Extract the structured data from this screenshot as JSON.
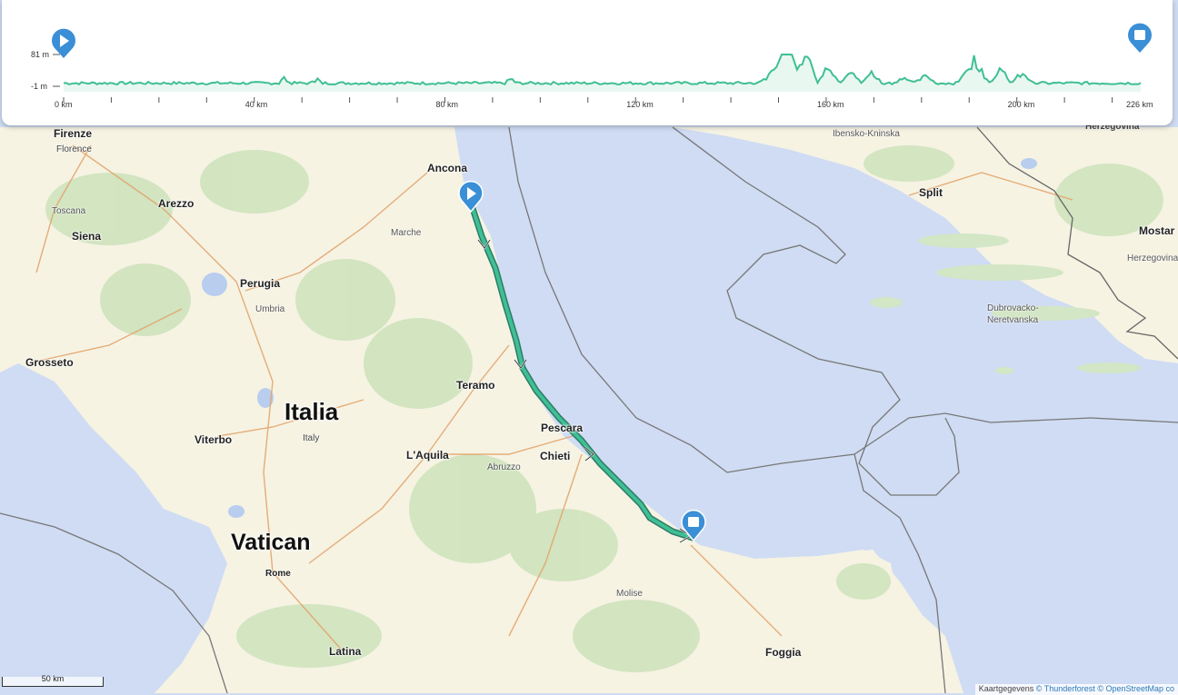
{
  "elevation_profile": {
    "y_axis": {
      "max_label": "81 m",
      "min_label": "-1 m"
    },
    "x_axis": {
      "labels": [
        "0 km",
        "40 km",
        "80 km",
        "120 km",
        "160 km",
        "200 km",
        "226 km"
      ]
    },
    "total_distance_km": 226,
    "line_color": "#3fbf94",
    "start_icon": "play-marker-icon",
    "end_icon": "finish-square-marker-icon"
  },
  "route": {
    "color": "#3c9a84",
    "start_icon": "play-marker-icon",
    "end_icon": "finish-square-marker-icon",
    "direction_icon": "route-direction-arrow-icon"
  },
  "map_labels": {
    "firenze": "Firenze",
    "florence": "Florence",
    "ancona": "Ancona",
    "arezzo": "Arezzo",
    "toscana": "Toscana",
    "siena": "Siena",
    "marche": "Marche",
    "perugia": "Perugia",
    "umbria": "Umbria",
    "grosseto": "Grosseto",
    "teramo": "Teramo",
    "italia": "Italia",
    "italy": "Italy",
    "pescara": "Pescara",
    "viterbo": "Viterbo",
    "laquila": "L'Aquila",
    "chieti": "Chieti",
    "abruzzo": "Abruzzo",
    "vatican": "Vatican",
    "rome": "Rome",
    "molise": "Molise",
    "latina": "Latina",
    "foggia": "Foggia",
    "split": "Split",
    "sibensko": "Ibensko-Kninska",
    "mostar": "Mostar",
    "herzegovina_top": "Herzegovina",
    "herzegovina_right": "Herzegovina-I",
    "dubrovacko1": "Dubrovacko-",
    "dubrovacko2": "Neretvanska"
  },
  "scale": {
    "label": "50 km"
  },
  "attribution": {
    "prefix": "Kaartgegevens",
    "tf": "© Thunderforest",
    "osm": "© OpenStreetMap co"
  },
  "colors": {
    "sea": "#cfdcf3",
    "land": "#f7f4e4",
    "forest": "#cfe2bf",
    "road": "#e7a56a",
    "marker": "#3a8fd6"
  }
}
